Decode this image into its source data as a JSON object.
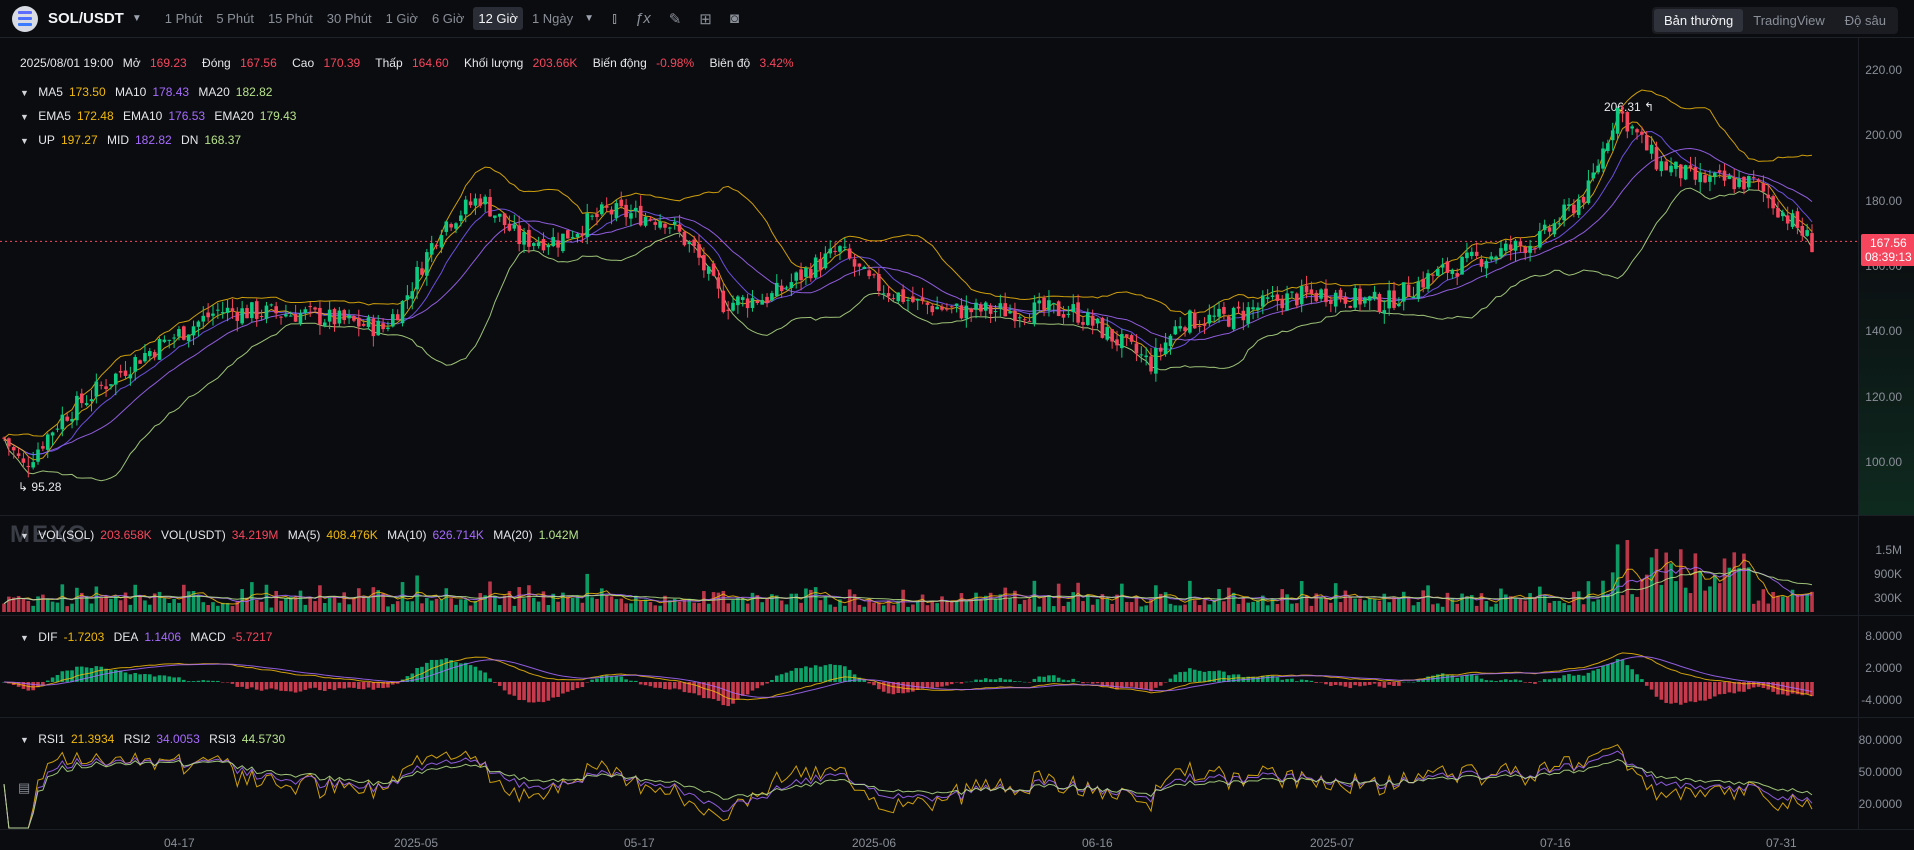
{
  "header": {
    "pair": "SOL/USDT",
    "intervals": [
      "1 Phút",
      "5 Phút",
      "15 Phút",
      "30 Phút",
      "1 Giờ",
      "6 Giờ",
      "12 Giờ",
      "1 Ngày"
    ],
    "active_interval": "12 Giờ",
    "modes": [
      "Bản thường",
      "TradingView",
      "Độ sâu"
    ],
    "active_mode": "Bản thường"
  },
  "ohlc": {
    "date": "2025/08/01 19:00",
    "open_label": "Mở",
    "open": "169.23",
    "close_label": "Đóng",
    "close": "167.56",
    "high_label": "Cao",
    "high": "170.39",
    "low_label": "Thấp",
    "low": "164.60",
    "volume_label": "Khối lượng",
    "volume": "203.66K",
    "change_label": "Biến động",
    "change": "-0.98%",
    "amp_label": "Biên độ",
    "amp": "3.42%"
  },
  "ma": {
    "ma5_label": "MA5",
    "ma5": "173.50",
    "ma10_label": "MA10",
    "ma10": "178.43",
    "ma20_label": "MA20",
    "ma20": "182.82"
  },
  "ema": {
    "ema5_label": "EMA5",
    "ema5": "172.48",
    "ema10_label": "EMA10",
    "ema10": "176.53",
    "ema20_label": "EMA20",
    "ema20": "179.43"
  },
  "boll": {
    "up_label": "UP",
    "up": "197.27",
    "mid_label": "MID",
    "mid": "182.82",
    "dn_label": "DN",
    "dn": "168.37"
  },
  "price_axis": [
    "220.00",
    "200.00",
    "180.00",
    "160.00",
    "140.00",
    "120.00",
    "100.00"
  ],
  "current_price": "167.56",
  "countdown": "08:39:13",
  "high_marker": "206.31",
  "low_marker": "95.28",
  "watermark": "MEXC",
  "volume": {
    "vol_sol_label": "VOL(SOL)",
    "vol_sol": "203.658K",
    "vol_usdt_label": "VOL(USDT)",
    "vol_usdt": "34.219M",
    "ma5_label": "MA(5)",
    "ma5": "408.476K",
    "ma10_label": "MA(10)",
    "ma10": "626.714K",
    "ma20_label": "MA(20)",
    "ma20": "1.042M",
    "axis": [
      "1.5M",
      "900K",
      "300K"
    ]
  },
  "macd": {
    "dif_label": "DIF",
    "dif": "-1.7203",
    "dea_label": "DEA",
    "dea": "1.1406",
    "macd_label": "MACD",
    "macd": "-5.7217",
    "axis": [
      "8.0000",
      "2.0000",
      "-4.0000"
    ]
  },
  "rsi": {
    "rsi1_label": "RSI1",
    "rsi1": "21.3934",
    "rsi2_label": "RSI2",
    "rsi2": "34.0053",
    "rsi3_label": "RSI3",
    "rsi3": "44.5730",
    "axis": [
      "80.0000",
      "50.0000",
      "20.0000"
    ]
  },
  "x_axis": [
    "04-17",
    "2025-05",
    "05-17",
    "2025-06",
    "06-16",
    "2025-07",
    "07-16",
    "07-31"
  ],
  "colors": {
    "up": "#0ecb81",
    "down": "#f6465d",
    "ma5": "#f0b90b",
    "ma10": "#a66bff",
    "ma20": "#b7e28a"
  },
  "chart_data": {
    "type": "candlestick",
    "price_range": [
      90,
      225
    ],
    "anchors": [
      [
        0,
        112
      ],
      [
        4,
        104
      ],
      [
        12,
        118
      ],
      [
        28,
        135
      ],
      [
        44,
        148
      ],
      [
        62,
        147
      ],
      [
        78,
        143
      ],
      [
        82,
        150
      ],
      [
        90,
        172
      ],
      [
        98,
        180
      ],
      [
        106,
        168
      ],
      [
        114,
        168
      ],
      [
        124,
        176
      ],
      [
        136,
        174
      ],
      [
        142,
        165
      ],
      [
        148,
        150
      ],
      [
        158,
        152
      ],
      [
        166,
        160
      ],
      [
        172,
        165
      ],
      [
        178,
        156
      ],
      [
        188,
        150
      ],
      [
        196,
        148
      ],
      [
        206,
        148
      ],
      [
        220,
        148
      ],
      [
        236,
        133
      ],
      [
        242,
        145
      ],
      [
        252,
        146
      ],
      [
        262,
        151
      ],
      [
        272,
        153
      ],
      [
        284,
        150
      ],
      [
        294,
        158
      ],
      [
        304,
        163
      ],
      [
        316,
        168
      ],
      [
        326,
        182
      ],
      [
        332,
        205
      ],
      [
        340,
        190
      ],
      [
        348,
        185
      ],
      [
        360,
        184
      ],
      [
        368,
        173
      ],
      [
        372,
        167
      ]
    ]
  }
}
